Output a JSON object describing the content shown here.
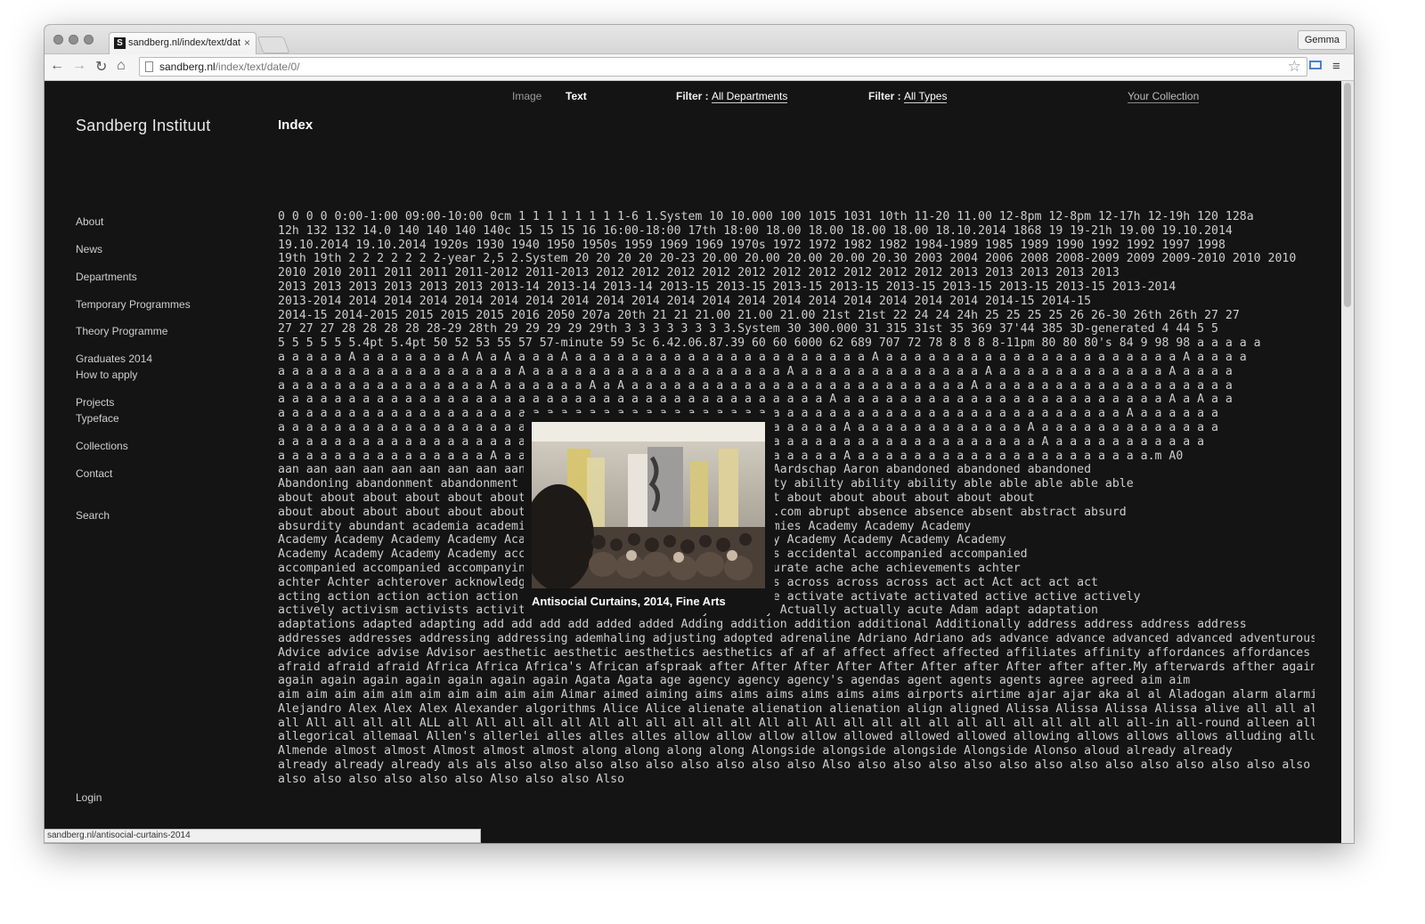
{
  "browser": {
    "tab_title": "sandberg.nl/index/text/date",
    "tab_close": "×",
    "favicon": "S",
    "profile": "Gemma",
    "url_host": "sandberg.nl",
    "url_path": "/index/text/date/0/",
    "status_url": "sandberg.nl/antisocial-curtains-2014",
    "icons": {
      "back": "back-arrow-icon",
      "forward": "forward-arrow-icon",
      "reload": "reload-icon",
      "home": "home-icon",
      "star": "star-icon",
      "menu": "hamburger-menu-icon"
    }
  },
  "site": {
    "logo": "Sandberg Instituut",
    "page_title": "Index",
    "topnav": {
      "image": "Image",
      "text": "Text",
      "filter_label": "Filter :",
      "filter_departments": "All Departments",
      "filter_types": "All Types",
      "collection": "Your Collection"
    },
    "sidenav": [
      "About",
      "News",
      "Departments",
      "Temporary Programmes",
      "Theory Programme",
      "Graduates 2014",
      "How to apply",
      "Projects",
      "Typeface",
      "Collections",
      "Contact",
      "Search"
    ],
    "login": "Login"
  },
  "preview": {
    "caption": "Antisocial Curtains, 2014, Fine Arts"
  },
  "index_lines": [
    "0 0 0 0 0:00-1:00 09:00-10:00 0cm 1 1 1 1 1 1 1 1-6 1.System 10 10.000 100 1015 1031 10th 11-20 11.00 12-8pm 12-8pm 12-17h 12-19h 120 128a",
    "12h 132 132 14.0 140 140 140 140c 15 15 15 16 16:00-18:00 17th 18:00 18.00 18.00 18.00 18.00 18.10.2014 1868 19 19-21h 19.00 19.10.2014",
    "19.10.2014 19.10.2014 1920s 1930 1940 1950 1950s 1959 1969 1969 1970s 1972 1972 1982 1982 1984-1989 1985 1989 1990 1992 1992 1997 1998",
    "19th 19th 2 2 2 2 2 2 2-year 2,5 2.System 20 20 20 20 20-23 20.00 20.00 20.00 20.00 20.30 2003 2004 2006 2008 2008-2009 2009 2009-2010 2010 2010",
    "2010 2010 2011 2011 2011 2011-2012 2011-2013 2012 2012 2012 2012 2012 2012 2012 2012 2012 2012 2013 2013 2013 2013 2013",
    "2013 2013 2013 2013 2013 2013 2013-14 2013-14 2013-14 2013-15 2013-15 2013-15 2013-15 2013-15 2013-15 2013-15 2013-15 2013-2014",
    "2013-2014 2014 2014 2014 2014 2014 2014 2014 2014 2014 2014 2014 2014 2014 2014 2014 2014 2014 2014 2014-15 2014-15",
    "2014-15 2014-2015 2015 2015 2015 2016 2050 207a 20th 21 21 21.00 21.00 21.00 21st 21st 22 24 24 24h 25 25 25 25 26 26-30 26th 26th 27 27",
    "27 27 27 28 28 28 28 28-29 28th 29 29 29 29 29th 3 3 3 3 3 3 3 3.System 30 300.000 31 315 31st 35 369 37'44 385 3D-generated 4 44 5 5",
    "5 5 5 5 5 5.4pt 5.4pt 50 52 53 55 57 57-minute 59 5c 6.42.06.87.39 60 60 6000 62 689 707 72 78 8 8 8 8-11pm 80 80 80's 84 9 98 98 a a a a a",
    "a a a a a A a a a a a a a A A a A a a a A a a a a a a a a a a a a a a a a a a a a a A a a a a a a a a a a a a a a a a a a a a a A a a a a",
    "a a a a a a a a a a a a a a a a a A a a a a a a a a a a a a a a a a a a A a a a a a a a a a a a a a A a a a a a a a a a a a a A a a a a",
    "a a a a a a a a a a a a a a a A a a a a a a A a A a a a a a a a a a a a a a a a a a a a a a a a a A a a a a a a a a a a a a a a a a a a",
    "a a a a a a a a a a a a a a a a a a a a a a a a a a a a a a a a a a a a a a a A a a a a a a a a a a a a a a a a a a a a a a a A a A a a",
    "a a a a a a a a a a a a a a a a a a a a a a a a a a a a a a a a a a a a a a a a a a a a a a a a a a a a a a a a a a a a A a a a a a a",
    "a a a a a a a a a a a a a a a a a a a a a a a a a a a a a a a A a a a a a a a a A a a a a a a a a a a a a A a a a a a a a a a a a a a",
    "a a a a a a a a a a a a a a a a a a a a a a a a a a a a a a a a a a a a a a a a a a a a a a a a a a a a a a A a a a a a a a a a a a",
    "a a a a a a a a a a a a a a a A a a a a a a a a a a a a a A A a a a a a a a a a A a a a a a a a a a a a a a a a a a a a a a.m A0",
    "aan aan aan aan aan aan aan aan aan aan Aardschap Aardschap Aardschap Aardschap Aaron abandoned abandoned abandoned",
    "Abandoning abandonment abandonment abandonment Abbemuseum Abbink ability ability ability ability able able able able able",
    "about about about about about about about about about about about About about about about about about about",
    "about about about about about about about about above abrunozhu.tumblr.com abrupt absence absence absent abstract absurd",
    "absurdity abundant academia academic Academie Academie academies academies Academy Academy Academy",
    "Academy Academy Academy Academy Academy Academy Academy Academy Academy Academy Academy Academy Academy",
    "Academy Academy Academy Academy accepted accepting access access access accidental accompanied accompanied",
    "accompanied accompanied accompanying according according According accurate ache ache achievements achter",
    "achter Achter achterover acknowledge acquainted acquiring across across across across across act act Act act act act",
    "acting action action action action act actions actions actions activate activate activate activated active active actively",
    "actively activism activists activities actual actual actually actually Actually actually acute Adam adapt adaptation",
    "adaptations adapted adapting add add add add added added Adding addition addition additional Additionally address address address address",
    "addresses addresses addressing addressing ademhaling adjusting adopted adrenaline Adriano Adriano ads advance advance advanced advanced adventurous",
    "Advice advice advise Advisor aesthetic aesthetic aesthetics aesthetics af af af affect affect affected affiliates affinity affordances affordances afraid",
    "afraid afraid afraid Africa Africa Africa's African afspraak after After After After After After after After after after.My afterwards afther again again again",
    "again again again again again again again Agata Agata age agency agency agency's agendas agent agents agents agree agreed aim aim",
    "aim aim aim aim aim aim aim aim aim aim Aimar aimed aiming aims aims aims aims aims aims airports airtime ajar ajar aka al al Aladogan alarm alarming",
    "Alejandro Alex Alex Alex Alexander algorithms Alice Alice alienate alienation alienation align aligned Alissa Alissa Alissa Alissa alive all all all all all all all",
    "all All all all all ALL all All all all all All all all all all all All all All all all all all all all all all all all all-in all-round alleen alleged",
    "allegorical allemaal Allen's allerlei alles alles alles allow allow allow allow allowed allowed allowed allowing allows allows allows alluding allusions Almende",
    "Almende almost almost Almost almost almost along along along along Alongside alongside alongside Alongside Alonso aloud already already",
    "already already already als als also also also also also also also also also Also also also also also also also also also also also also also also also also",
    "also also also also also also Also also also Also"
  ]
}
